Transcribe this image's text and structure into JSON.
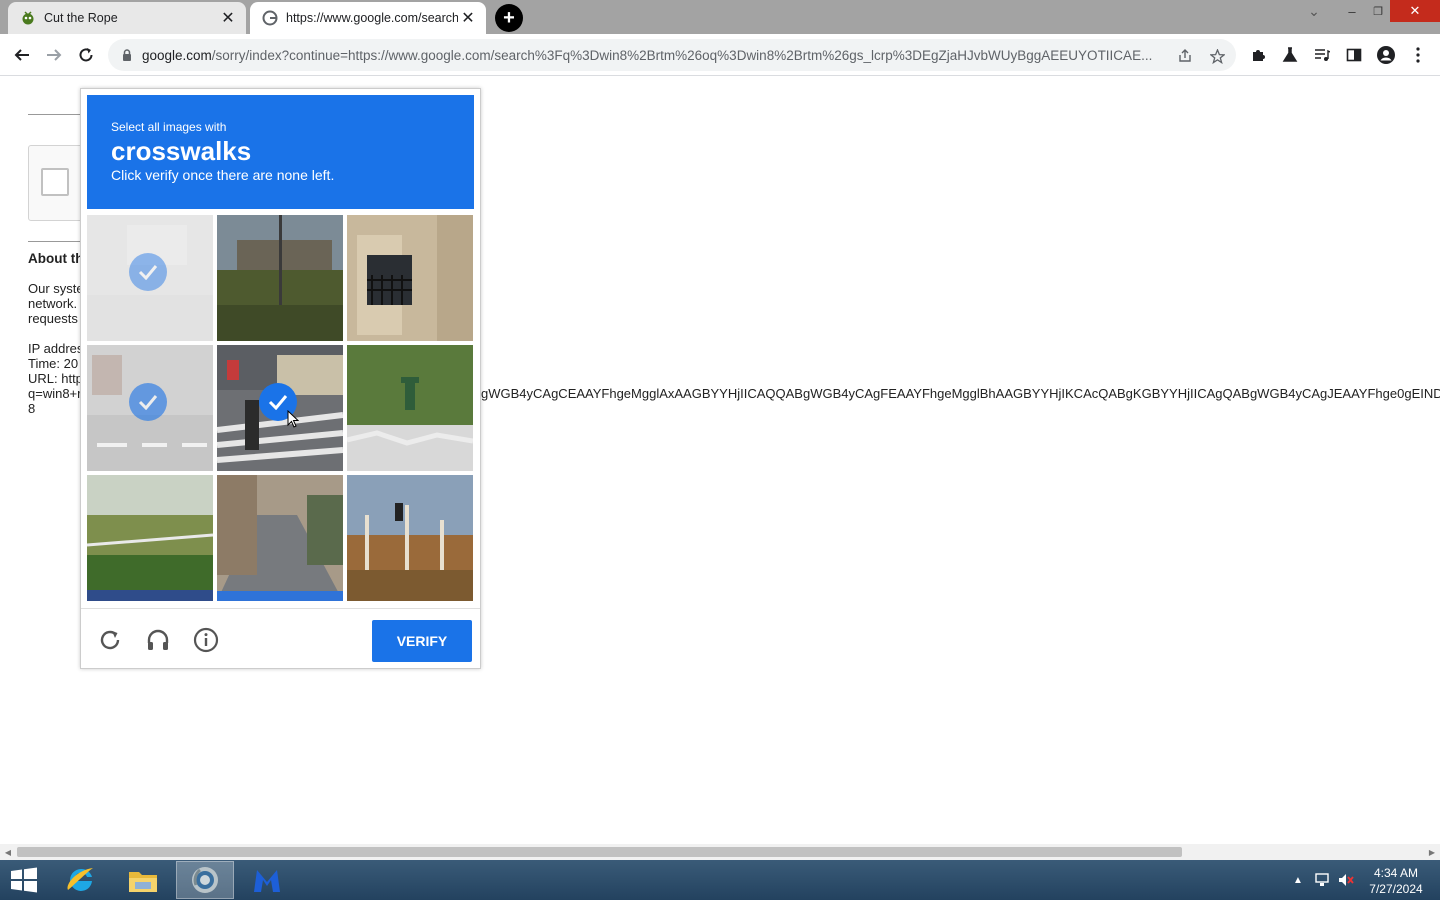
{
  "browser": {
    "tabs": [
      {
        "title": "Cut the Rope",
        "active": false
      },
      {
        "title": "https://www.google.com/search",
        "active": true
      }
    ],
    "new_tab_label": "+",
    "window_controls": {
      "minimize": "–",
      "restore": "❐",
      "close": "✕"
    },
    "url_host": "google.com",
    "url_path": "/sorry/index?continue=https://www.google.com/search%3Fq%3Dwin8%2Brtm%26oq%3Dwin8%2Brtm%26gs_lcrp%3DEgZjaHJvbWUyBggAEEUYOTIICAE..."
  },
  "page": {
    "about_heading": "About th",
    "para_lines": [
      "Our syste",
      "network.",
      "requests"
    ],
    "meta_lines": [
      "IP addres",
      "Time: 20",
      "URL: http",
      "q=win8+r",
      "8"
    ],
    "overflow_text": "gWGB4yCAgCEAAYFhgeMgglAxAAGBYYHjIICAQQABgWGB4yCAgFEAAYFhgeMgglBhAAGBYYHjIKCAcQABgKGBYYHjIICAgQABgWGB4yCAgJEAAYFhge0gEIND"
  },
  "captcha": {
    "instruction_line1": "Select all images with",
    "target": "crosswalks",
    "instruction_line2": "Click verify once there are none left.",
    "verify_label": "VERIFY",
    "tiles": [
      {
        "name": "tile-1",
        "selected": true,
        "faded": true
      },
      {
        "name": "tile-2",
        "selected": false
      },
      {
        "name": "tile-3",
        "selected": false
      },
      {
        "name": "tile-4",
        "selected": true,
        "faded": true
      },
      {
        "name": "tile-5",
        "selected": true
      },
      {
        "name": "tile-6",
        "selected": false
      },
      {
        "name": "tile-7",
        "selected": false
      },
      {
        "name": "tile-8",
        "selected": false
      },
      {
        "name": "tile-9",
        "selected": false
      }
    ],
    "footer_icons": [
      "reload-icon",
      "audio-challenge-icon",
      "info-icon"
    ],
    "accent": "#1a73e8"
  },
  "taskbar": {
    "apps": [
      "start-button",
      "internet-explorer",
      "file-explorer",
      "chrome",
      "malwarebytes"
    ],
    "active_app": "chrome",
    "time": "4:34 AM",
    "date": "7/27/2024"
  }
}
